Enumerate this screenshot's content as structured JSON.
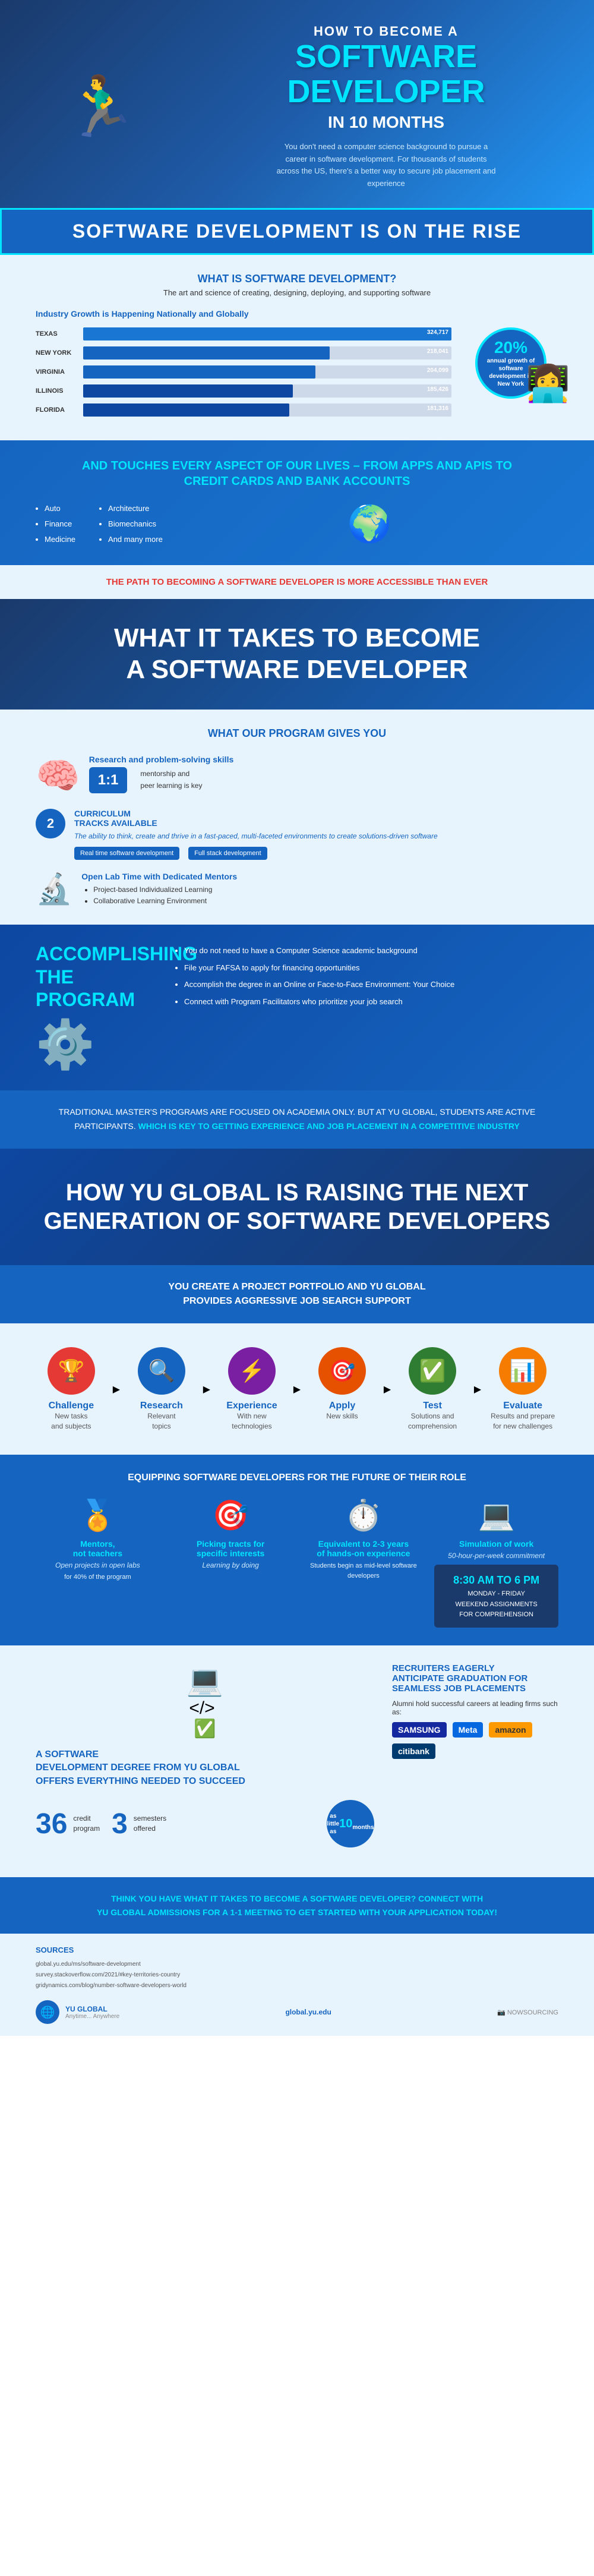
{
  "hero": {
    "how_to": "HOW TO BECOME A",
    "main_title": "SOFTWARE\nDEVELOPER",
    "in_time": "IN 10 MONTHS",
    "subtitle": "You don't need a computer science background to pursue a career in software development. For thousands of students across the US, there's a better way to secure job placement and experience"
  },
  "banner": {
    "title": "SOFTWARE DEVELOPMENT IS ON THE RISE"
  },
  "what_is": {
    "heading": "WHAT IS SOFTWARE DEVELOPMENT?",
    "subtitle": "The art and science of creating, designing, deploying, and supporting software",
    "industry_heading": "Industry Growth is Happening Nationally and Globally",
    "bars": [
      {
        "label": "TEXAS",
        "value": "324,717",
        "width": 100
      },
      {
        "label": "NEW YORK",
        "value": "218,041",
        "width": 67
      },
      {
        "label": "VIRGINIA",
        "value": "204,099",
        "width": 63
      },
      {
        "label": "ILLINOIS",
        "value": "185,426",
        "width": 57
      },
      {
        "label": "FLORIDA",
        "value": "181,316",
        "width": 56
      }
    ],
    "growth_pct": "20%",
    "growth_desc": "annual growth of software development in New York"
  },
  "touches": {
    "header": "AND TOUCHES EVERY ASPECT OF OUR\nLIVES – FROM APPS AND APIS TO\nCREDIT CARDS AND BANK ACCOUNTS",
    "col1": [
      "Auto",
      "Finance",
      "Medicine"
    ],
    "col2": [
      "Architecture",
      "Biomechanics",
      "And many more"
    ]
  },
  "path": {
    "text": "THE PATH TO BECOMING A SOFTWARE DEVELOPER IS ",
    "highlight": "MORE ACCESSIBLE THAN EVER"
  },
  "what_it_takes": {
    "heading": "WHAT IT TAKES TO BECOME\nA SOFTWARE DEVELOPER"
  },
  "program": {
    "heading": "WHAT OUR PROGRAM GIVES YOU",
    "items": [
      {
        "number": "1:1",
        "label": "mentorship and\npeer learning is key",
        "heading": "Research and problem-solving skills"
      },
      {
        "number": "2",
        "heading": "CURRICULUM\nTRACKS AVAILABLE",
        "italic": "The ability to think, create and thrive in a fast-paced, multi-faceted environments to create solutions-driven software",
        "tracks": [
          "Real time software development",
          "Full stack development"
        ]
      },
      {
        "heading": "Open Lab Time with Dedicated Mentors",
        "items": [
          "Project-based Individualized Learning",
          "Collaborative Learning Environment"
        ]
      }
    ]
  },
  "accomplishing": {
    "heading": "ACCOMPLISHING\nTHE PROGRAM",
    "items": [
      "You do not need to have a Computer Science academic background",
      "File your FAFSA to apply for financing opportunities",
      "Accomplish the degree in an Online or Face-to-Face Environment: Your Choice",
      "Connect with Program Facilitators who prioritize your job search"
    ]
  },
  "traditional": {
    "text": "TRADITIONAL MASTER'S PROGRAMS ARE FOCUSED ON ACADEMIA ONLY. BUT AT YU GLOBAL, STUDENTS ARE ACTIVE PARTICIPANTS. ",
    "highlight": "WHICH IS KEY TO GETTING EXPERIENCE AND JOB PLACEMENT IN A COMPETITIVE INDUSTRY"
  },
  "raising": {
    "heading": "HOW YU GLOBAL IS RAISING THE NEXT\nGENERATION OF SOFTWARE DEVELOPERS"
  },
  "portfolio": {
    "text": "YOU CREATE A PROJECT PORTFOLIO AND YU GLOBAL\nPROVIDES AGGRESSIVE JOB SEARCH SUPPORT"
  },
  "cycle": {
    "items": [
      {
        "label": "Challenge",
        "sub": "New tasks\nand subjects",
        "icon": "🏆",
        "color": "challenge"
      },
      {
        "label": "Research",
        "sub": "Relevant\ntopics",
        "icon": "🔍",
        "color": "research"
      },
      {
        "label": "Experience",
        "sub": "With new\ntechnologies",
        "icon": "⚡",
        "color": "experience"
      },
      {
        "label": "Apply",
        "sub": "New skills",
        "icon": "🎯",
        "color": "apply"
      },
      {
        "label": "Test",
        "sub": "Solutions and\ncomprehension",
        "icon": "✅",
        "color": "test"
      },
      {
        "label": "Evaluate",
        "sub": "Results and prepare\nfor new challenges",
        "icon": "📊",
        "color": "evaluate"
      }
    ]
  },
  "equipping": {
    "heading": "EQUIPPING SOFTWARE DEVELOPERS FOR THE FUTURE OF THEIR ROLE",
    "items": [
      {
        "icon": "🏅",
        "title": "Mentors,\nnot teachers",
        "sub": "Open projects in open labs",
        "desc": "for 40% of the program"
      },
      {
        "icon": "🎯",
        "title": "Picking tracts for\nspecific interests",
        "sub": "Learning by doing",
        "desc": ""
      },
      {
        "icon": "⏱️",
        "title": "Equivalent to 2-3 years\nof hands-on experience",
        "sub": "",
        "desc": "Students begin as mid-level software developers"
      },
      {
        "icon": "💻",
        "title": "Simulation of work",
        "sub": "50-hour-per-week commitment",
        "desc": "8:30 AM TO 6 PM\nMONDAY - FRIDAY\nWEEKEND ASSIGNMENTS\nFOR COMPREHENSION"
      }
    ]
  },
  "degree": {
    "heading": "A SOFTWARE\nDEGREE DEGREE FROM YU GLOBAL\nOFFERS EVERYTHING NEEDED TO SUCCEED",
    "credits": "36",
    "credits_label": "credit\nprogram",
    "semesters": "3",
    "semesters_label": "semesters\noffered",
    "as_little": "as little as\n10\nmonths",
    "recruiters": "RECRUITERS EAGERLY\nANTICIPATE GRADUATION FOR\nSEAMLESS JOB PLACEMENTS",
    "alumni_note": "Alumni hold successful careers at leading firms such as:",
    "companies": [
      "SAMSUNG",
      "Meta",
      "amazon",
      "citibank"
    ]
  },
  "cta": {
    "text": "THINK YOU HAVE WHAT IT TAKES TO BECOME A SOFTWARE DEVELOPER? CONNECT WITH\nYU GLOBAL ADMISSIONS FOR A 1-1 MEETING TO GET STARTED WITH YOUR APPLICATION TODAY!"
  },
  "sources": {
    "heading": "SOURCES",
    "links": [
      "global.yu.edu/ms/software-development",
      "survey.stackoverflow.com/2021/#key-territories-country",
      "gridynamics.com/blog/number-software-developers-world"
    ],
    "global_url": "global.yu.edu",
    "yu_global_label": "YU GLOBAL",
    "tagline": "Anytime... Anywhere",
    "nowsourcing": "NOWSOURCING"
  },
  "for_comprehension": {
    "label": "FOR COMPREHENSION"
  }
}
